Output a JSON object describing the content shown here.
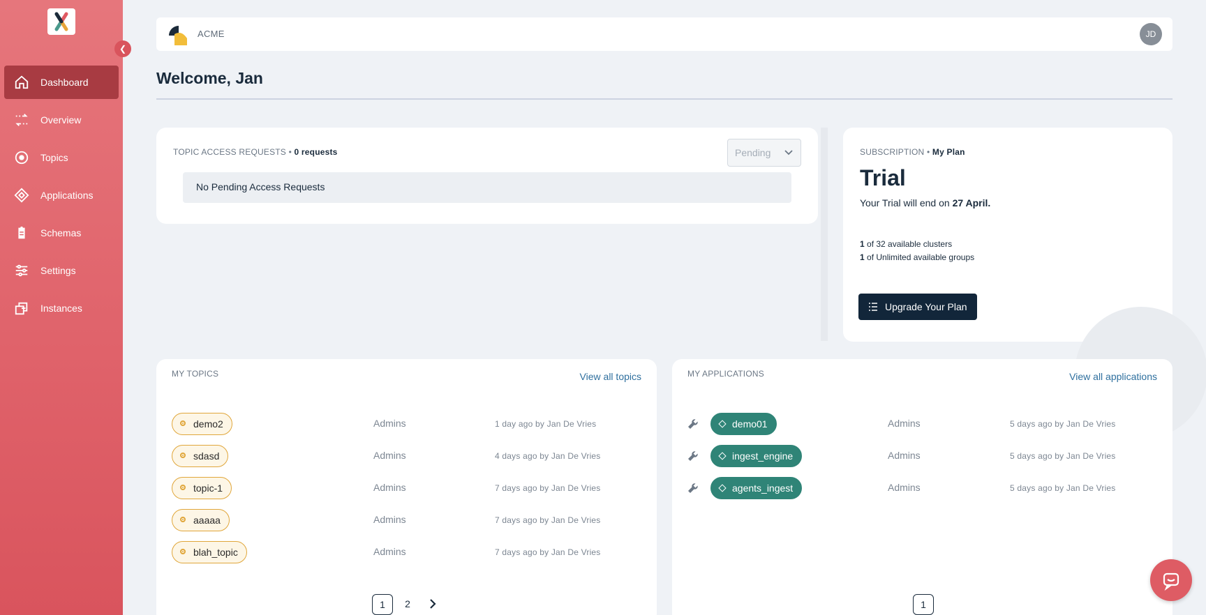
{
  "sidebar": {
    "collapse_icon": "chevron-left-icon",
    "items": [
      {
        "label": "Dashboard",
        "icon": "home-icon",
        "active": true
      },
      {
        "label": "Overview",
        "icon": "flow-icon"
      },
      {
        "label": "Topics",
        "icon": "target-icon"
      },
      {
        "label": "Applications",
        "icon": "diamond-icon"
      },
      {
        "label": "Schemas",
        "icon": "clipboard-icon"
      },
      {
        "label": "Settings",
        "icon": "sliders-icon"
      },
      {
        "label": "Instances",
        "icon": "stack-icon"
      }
    ]
  },
  "header": {
    "org_name": "ACME",
    "avatar_initials": "JD"
  },
  "page": {
    "title": "Welcome, Jan"
  },
  "access_requests": {
    "title": "TOPIC ACCESS REQUESTS",
    "count": "0 requests",
    "filter_value": "Pending",
    "empty_message": "No Pending Access Requests"
  },
  "subscription": {
    "title": "SUBSCRIPTION",
    "subtitle": "My Plan",
    "plan": "Trial",
    "end_prefix": "Your Trial will end on",
    "end_date": "27 April.",
    "clusters_used": "1",
    "clusters_text": "of 32 available clusters",
    "groups_used": "1",
    "groups_text": "of Unlimited available groups",
    "upgrade_label": "Upgrade Your Plan"
  },
  "my_topics": {
    "title": "MY TOPICS",
    "view_all": "View all topics",
    "rows": [
      {
        "name": "demo2",
        "owner": "Admins",
        "when": "1 day ago by Jan De Vries"
      },
      {
        "name": "sdasd",
        "owner": "Admins",
        "when": "4 days ago by Jan De Vries"
      },
      {
        "name": "topic-1",
        "owner": "Admins",
        "when": "7 days ago by Jan De Vries"
      },
      {
        "name": "aaaaa",
        "owner": "Admins",
        "when": "7 days ago by Jan De Vries"
      },
      {
        "name": "blah_topic",
        "owner": "Admins",
        "when": "7 days ago by Jan De Vries"
      }
    ],
    "pages": [
      "1",
      "2"
    ],
    "current_page": "1"
  },
  "my_applications": {
    "title": "MY APPLICATIONS",
    "view_all": "View all applications",
    "rows": [
      {
        "name": "demo01",
        "owner": "Admins",
        "when": "5 days ago by Jan De Vries"
      },
      {
        "name": "ingest_engine",
        "owner": "Admins",
        "when": "5 days ago by Jan De Vries"
      },
      {
        "name": "agents_ingest",
        "owner": "Admins",
        "when": "5 days ago by Jan De Vries"
      }
    ],
    "pages": [
      "1"
    ],
    "current_page": "1"
  },
  "colors": {
    "sidebar": "#e0636b",
    "active_nav": "#a83b42",
    "topic_chip": "#e0a63a",
    "app_chip": "#2f8477",
    "primary_button": "#12263a",
    "link": "#2e6f9e"
  }
}
